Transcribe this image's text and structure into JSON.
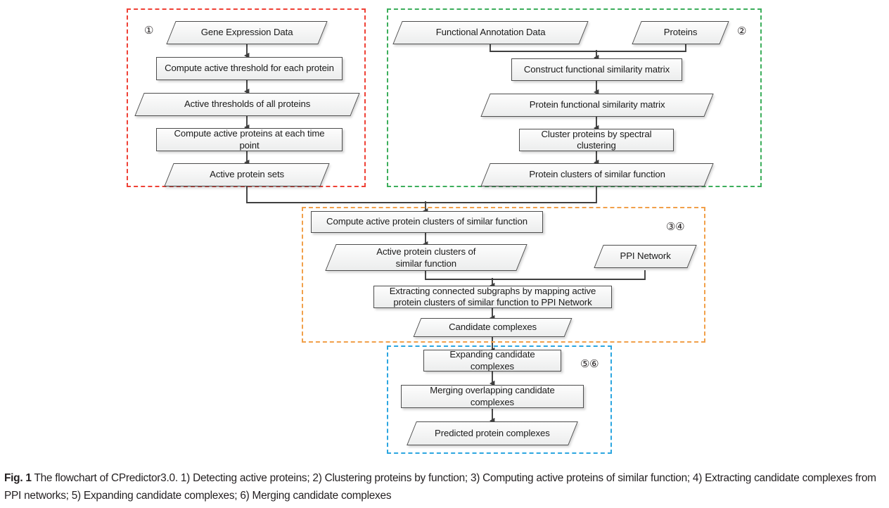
{
  "figure": {
    "caption_label": "Fig. 1",
    "caption_text": " The flowchart of CPredictor3.0. 1) Detecting active proteins; 2) Clustering proteins by function; 3) Computing active proteins of similar function; 4) Extracting candidate complexes from PPI networks; 5) Expanding candidate complexes; 6) Merging candidate complexes"
  },
  "groups": {
    "g1": {
      "label": "①",
      "color": "#ef4136"
    },
    "g2": {
      "label": "②",
      "color": "#3cae5b"
    },
    "g34": {
      "label": "③④",
      "color": "#f1a04a"
    },
    "g56": {
      "label": "⑤⑥",
      "color": "#2ca6e0"
    }
  },
  "nodes": {
    "gene_expression_data": "Gene Expression Data",
    "compute_active_threshold": "Compute active threshold for each protein",
    "active_thresholds_all": "Active thresholds of all proteins",
    "compute_active_proteins": "Compute  active proteins at each time point",
    "active_protein_sets": "Active protein sets",
    "functional_annotation_data": "Functional Annotation Data",
    "proteins": "Proteins",
    "construct_functional_similarity_matrix": "Construct functional similarity matrix",
    "protein_functional_similarity_matrix": "Protein functional similarity matrix",
    "cluster_proteins_spectral": "Cluster proteins by spectral clustering",
    "protein_clusters_similar_function": "Protein clusters of similar function",
    "compute_active_protein_clusters": "Compute active protein clusters of similar function",
    "active_protein_clusters_similar_function": "Active protein clusters of\nsimilar function",
    "ppi_network": "PPI Network",
    "extracting_connected_subgraphs": "Extracting connected subgraphs by mapping active\nprotein clusters of similar function to PPI Network",
    "candidate_complexes": "Candidate complexes",
    "expanding_candidate_complexes": "Expanding  candidate complexes",
    "merging_overlapping_candidate_complexes": "Merging overlapping  candidate complexes",
    "predicted_protein_complexes": "Predicted protein complexes"
  },
  "colors": {
    "connector": "#3f3f3f",
    "node_border": "#4d4d4d",
    "text": "#1a1a1a"
  }
}
